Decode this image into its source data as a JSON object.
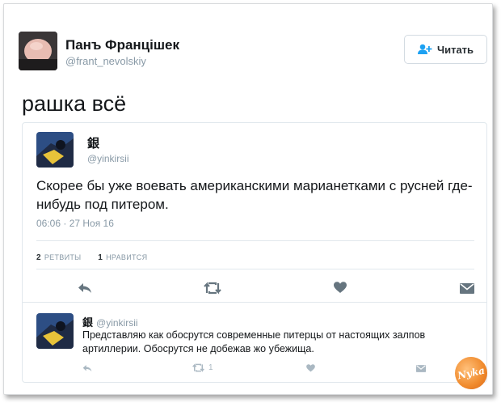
{
  "author": {
    "name": "Панъ Францішек",
    "handle": "@frant_nevolskiy",
    "follow_label": "Читать"
  },
  "tweet_text": "рашка всё",
  "quoted": {
    "name": "銀",
    "handle": "@yinkirsii",
    "text": "Скорее бы уже воевать американскими марианетками с русней где-нибудь под питером.",
    "timestamp": "06:06 · 27 Ноя 16",
    "retweets_count": "2",
    "retweets_label": "РЕТВИТЫ",
    "likes_count": "1",
    "likes_label": "НРАВИТСЯ"
  },
  "reply": {
    "name": "銀",
    "handle": "@yinkirsii",
    "text": "Представляю как обосрутся современные питерцы от настоящих залпов артиллерии. Обосрутся не добежав жо убежища.",
    "retweet_count": "1"
  },
  "watermark": "Nyka",
  "colors": {
    "icon_gray": "#66757f",
    "muted": "#8899a6",
    "accent": "#1da1f2"
  }
}
